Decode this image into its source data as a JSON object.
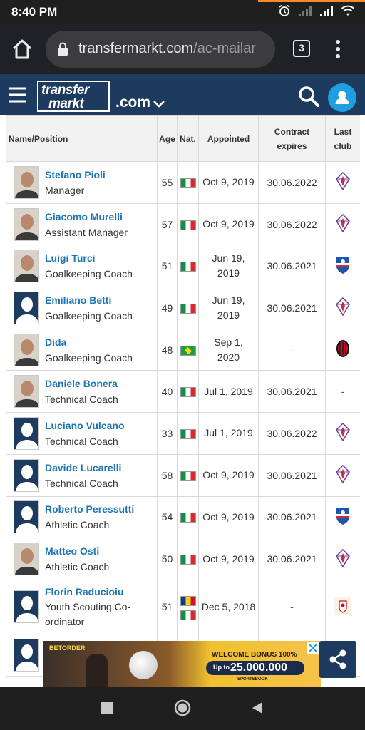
{
  "status_bar": {
    "time": "8:40 PM",
    "icons": [
      "alarm-icon",
      "signal-icon",
      "signal-icon",
      "wifi-icon"
    ]
  },
  "browser": {
    "url_domain": "transfermarkt.com",
    "url_path": "/ac-mailar",
    "tab_count": "3"
  },
  "site_header": {
    "logo_line1": "transfer",
    "logo_line2": "markt",
    "logo_suffix": ".com"
  },
  "table": {
    "headers": {
      "name": "Name/Position",
      "age": "Age",
      "nat": "Nat.",
      "appointed": "Appointed",
      "contract_line1": "Contract",
      "contract_line2": "expires",
      "club_line1": "Last",
      "club_line2": "club"
    },
    "rows": [
      {
        "name": "Stefano Pioli",
        "role": "Manager",
        "age": "55",
        "appointed": "Oct 9, 2019",
        "contract": "30.06.2022"
      },
      {
        "name": "Giacomo Murelli",
        "role": "Assistant Manager",
        "age": "57",
        "appointed": "Oct 9, 2019",
        "contract": "30.06.2022"
      },
      {
        "name": "Luigi Turci",
        "role": "Goalkeeping Coach",
        "age": "51",
        "appointed_l1": "Jun 19,",
        "appointed_l2": "2019",
        "contract": "30.06.2021"
      },
      {
        "name": "Emiliano Betti",
        "role": "Goalkeeping Coach",
        "age": "49",
        "appointed_l1": "Jun 19,",
        "appointed_l2": "2019",
        "contract": "30.06.2021"
      },
      {
        "name": "Dida",
        "role": "Goalkeeping Coach",
        "age": "48",
        "appointed_l1": "Sep 1,",
        "appointed_l2": "2020",
        "contract": "-"
      },
      {
        "name": "Daniele Bonera",
        "role": "Technical Coach",
        "age": "40",
        "appointed": "Jul 1, 2019",
        "contract": "30.06.2021",
        "club": "-"
      },
      {
        "name": "Luciano Vulcano",
        "role": "Technical Coach",
        "age": "33",
        "appointed": "Jul 1, 2019",
        "contract": "30.06.2022"
      },
      {
        "name": "Davide Lucarelli",
        "role": "Technical Coach",
        "age": "58",
        "appointed": "Oct 9, 2019",
        "contract": "30.06.2021"
      },
      {
        "name": "Roberto Peressutti",
        "role": "Athletic Coach",
        "age": "54",
        "appointed": "Oct 9, 2019",
        "contract": "30.06.2021"
      },
      {
        "name": "Matteo Osti",
        "role": "Athletic Coach",
        "age": "50",
        "appointed": "Oct 9, 2019",
        "contract": "30.06.2021"
      },
      {
        "name": "Florin Raducioiu",
        "role_l1": "Youth Scouting Co-",
        "role_l2": "ordinator",
        "age": "51",
        "appointed": "Dec 5, 2018",
        "contract": "-"
      }
    ]
  },
  "ad": {
    "brand": "BETORDER",
    "bonus_label": "WELCOME BONUS 100%",
    "up_to": "Up to",
    "amount": "25.000.000",
    "tagline": "SPORTSBOOK"
  },
  "colors": {
    "header_bg": "#1d3b5e",
    "link": "#1d75b3",
    "user_button": "#1e9fe0"
  }
}
